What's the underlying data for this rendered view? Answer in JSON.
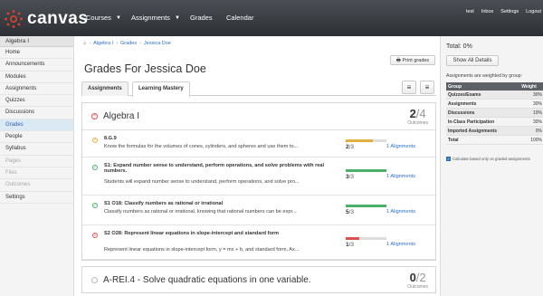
{
  "app": {
    "logo_text": "canvas"
  },
  "topnav": {
    "courses": "Courses",
    "assignments": "Assignments",
    "grades": "Grades",
    "calendar": "Calendar",
    "user_links": [
      "test",
      "Inbox",
      "Settings",
      "Logout"
    ]
  },
  "leftnav": {
    "course": "Algebra I",
    "items": [
      "Home",
      "Announcements",
      "Modules",
      "Assignments",
      "Quizzes",
      "Discussions",
      "Grades",
      "People",
      "Syllabus",
      "Pages",
      "Files",
      "Outcomes",
      "Settings"
    ],
    "active": "Grades",
    "dimmed": [
      "Pages",
      "Files",
      "Outcomes"
    ]
  },
  "breadcrumb": [
    "Algebra I",
    "Grades",
    "Jessica Doe"
  ],
  "page": {
    "title": "Grades For Jessica Doe",
    "print_label": "Print grades",
    "tabs": [
      "Assignments",
      "Learning Mastery"
    ],
    "active_tab": "Learning Mastery"
  },
  "groups": [
    {
      "name": "Algebra I",
      "score": "2",
      "total": "/4",
      "label": "Outcomes",
      "status": "fail",
      "outcomes": [
        {
          "title": "8.G.9",
          "desc": "Know the formulas for the volumes of cones, cylinders, and spheres and use them to...",
          "score": "2",
          "outof": "/3",
          "fraction": 0.67,
          "color": "#e0b040",
          "status": "warn",
          "align": "1 Alignments"
        },
        {
          "title": "S1: Expand number sense to understand, perform operations, and solve problems with real numbers.",
          "desc": "Students will expand number sense to understand, perform operations, and solve pro...",
          "score": "3",
          "outof": "/3",
          "fraction": 1.0,
          "color": "#4caf6a",
          "status": "pass",
          "align": "1 Alignments"
        },
        {
          "title": "S1 O18: Classify numbers as rational or irrational",
          "desc": "Classify numbers as rational or irrational, knowing that rational numbers can be expr...",
          "score": "5",
          "outof": "/3",
          "fraction": 1.0,
          "color": "#4caf6a",
          "status": "pass",
          "align": "1 Alignments"
        },
        {
          "title": "S2 O28: Represent linear equations in slope-intercept and standard form",
          "desc": "Represent linear equations in slope-intercept form, y = mx + b, and standard form, Ax...",
          "score": "1",
          "outof": "/3",
          "fraction": 0.33,
          "color": "#e0504a",
          "status": "fail",
          "align": "1 Alignments"
        }
      ]
    },
    {
      "name": "A-REI.4 - Solve quadratic equations in one variable.",
      "score": "0",
      "total": "/2",
      "label": "Outcomes",
      "status": "none"
    }
  ],
  "sidebar": {
    "total": "Total: 0%",
    "show_all": "Show All Details",
    "weighted_note": "Assignments are weighted by group:",
    "table_headers": [
      "Group",
      "Weight"
    ],
    "rows": [
      [
        "Quizzes/Exams",
        "30%"
      ],
      [
        "Assignments",
        "30%"
      ],
      [
        "Discussions",
        "10%"
      ],
      [
        "In-Class Participation",
        "30%"
      ],
      [
        "Imported Assignments",
        "0%"
      ],
      [
        "Total",
        "100%"
      ]
    ],
    "calc_note": "Calculate based only on graded assignments"
  },
  "colors": {
    "pass": "#4caf6a",
    "warn": "#e0b040",
    "fail": "#e0504a",
    "none": "#bbbbbb",
    "link": "#2a70c9",
    "logo": "#e0422f"
  }
}
